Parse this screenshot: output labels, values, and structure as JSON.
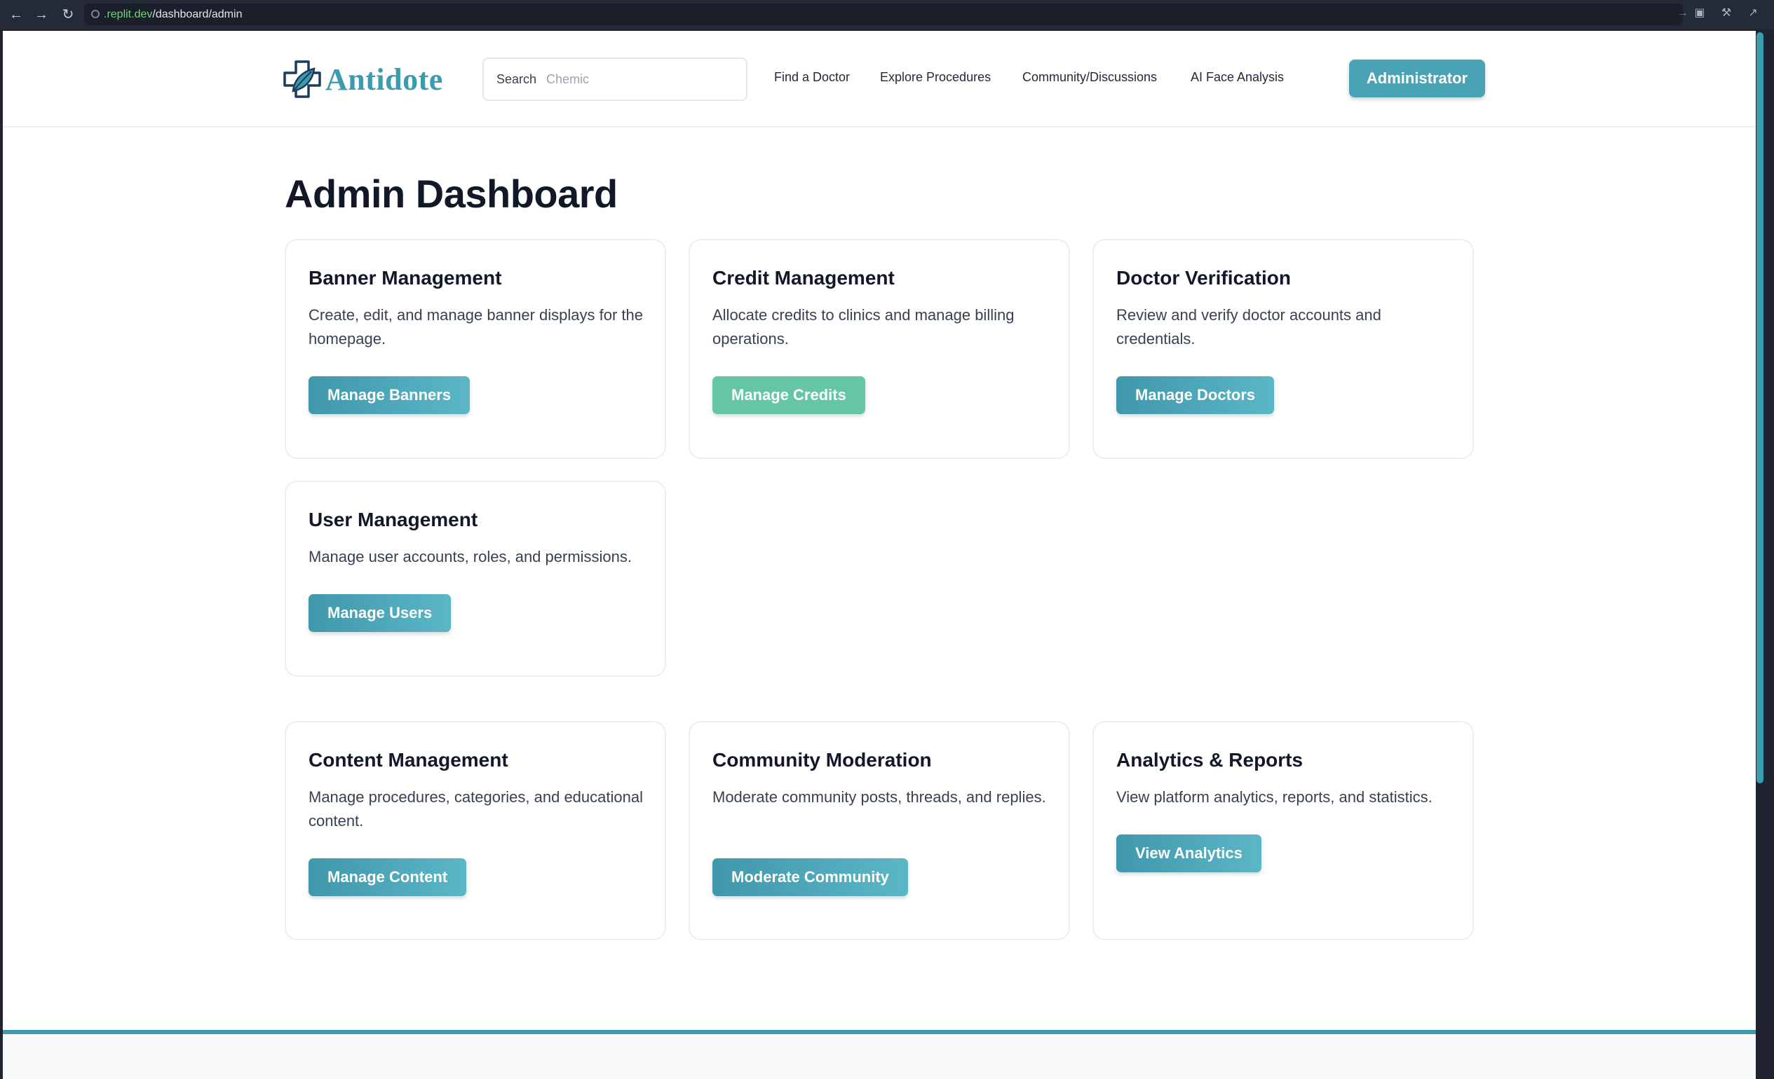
{
  "browser": {
    "url_host": ".replit.dev",
    "url_path": "/dashboard/admin"
  },
  "header": {
    "brand": "Antidote",
    "search_label": "Search",
    "search_placeholder": "Chemic",
    "nav": [
      "Find a Doctor",
      "Explore Procedures",
      "Community/Discussions",
      "AI Face Analysis"
    ],
    "admin_button": "Administrator"
  },
  "page": {
    "title": "Admin Dashboard"
  },
  "cards": [
    {
      "title": "Banner Management",
      "description": "Create, edit, and manage banner displays for the homepage.",
      "button": "Manage Banners"
    },
    {
      "title": "Credit Management",
      "description": "Allocate credits to clinics and manage billing operations.",
      "button": "Manage Credits"
    },
    {
      "title": "Doctor Verification",
      "description": "Review and verify doctor accounts and credentials.",
      "button": "Manage Doctors"
    },
    {
      "title": "User Management",
      "description": "Manage user accounts, roles, and permissions.",
      "button": "Manage Users"
    },
    {
      "title": "Content Management",
      "description": "Manage procedures, categories, and educational content.",
      "button": "Manage Content"
    },
    {
      "title": "Community Moderation",
      "description": "Moderate community posts, threads, and replies.",
      "button": "Moderate Community"
    },
    {
      "title": "Analytics & Reports",
      "description": "View platform analytics, reports, and statistics.",
      "button": "View Analytics"
    }
  ],
  "colors": {
    "brand": "#3b9cae",
    "credit_button": "#64c6a3"
  }
}
